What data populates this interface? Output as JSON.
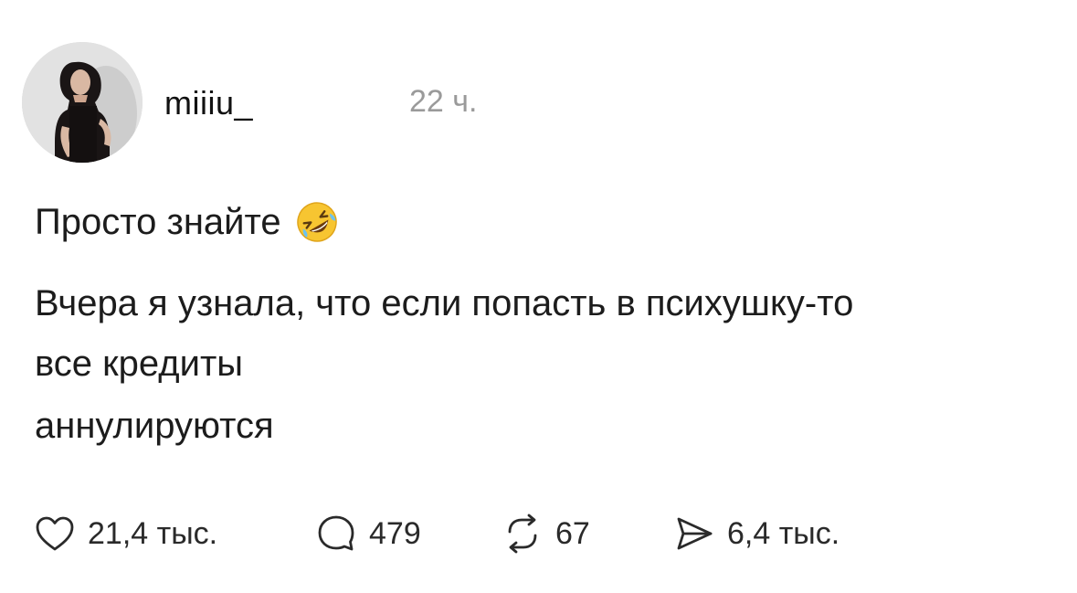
{
  "post": {
    "author": {
      "username": "miiiu_",
      "avatar_icon": "profile-photo"
    },
    "timestamp": "22 ч.",
    "title": "Просто знайте",
    "title_emoji": "rolling-on-floor-laughing-emoji",
    "body_lines": [
      "Вчера я узнала, что если попасть в психушку-то",
      "все кредиты",
      "аннулируются"
    ]
  },
  "actions": {
    "like": {
      "icon": "heart-icon",
      "count": "21,4 тыс."
    },
    "comment": {
      "icon": "comment-icon",
      "count": "479"
    },
    "repost": {
      "icon": "repost-icon",
      "count": "67"
    },
    "share": {
      "icon": "send-icon",
      "count": "6,4 тыс."
    }
  },
  "colors": {
    "text": "#1c1c1c",
    "muted": "#9a9a9a",
    "background": "#ffffff"
  }
}
